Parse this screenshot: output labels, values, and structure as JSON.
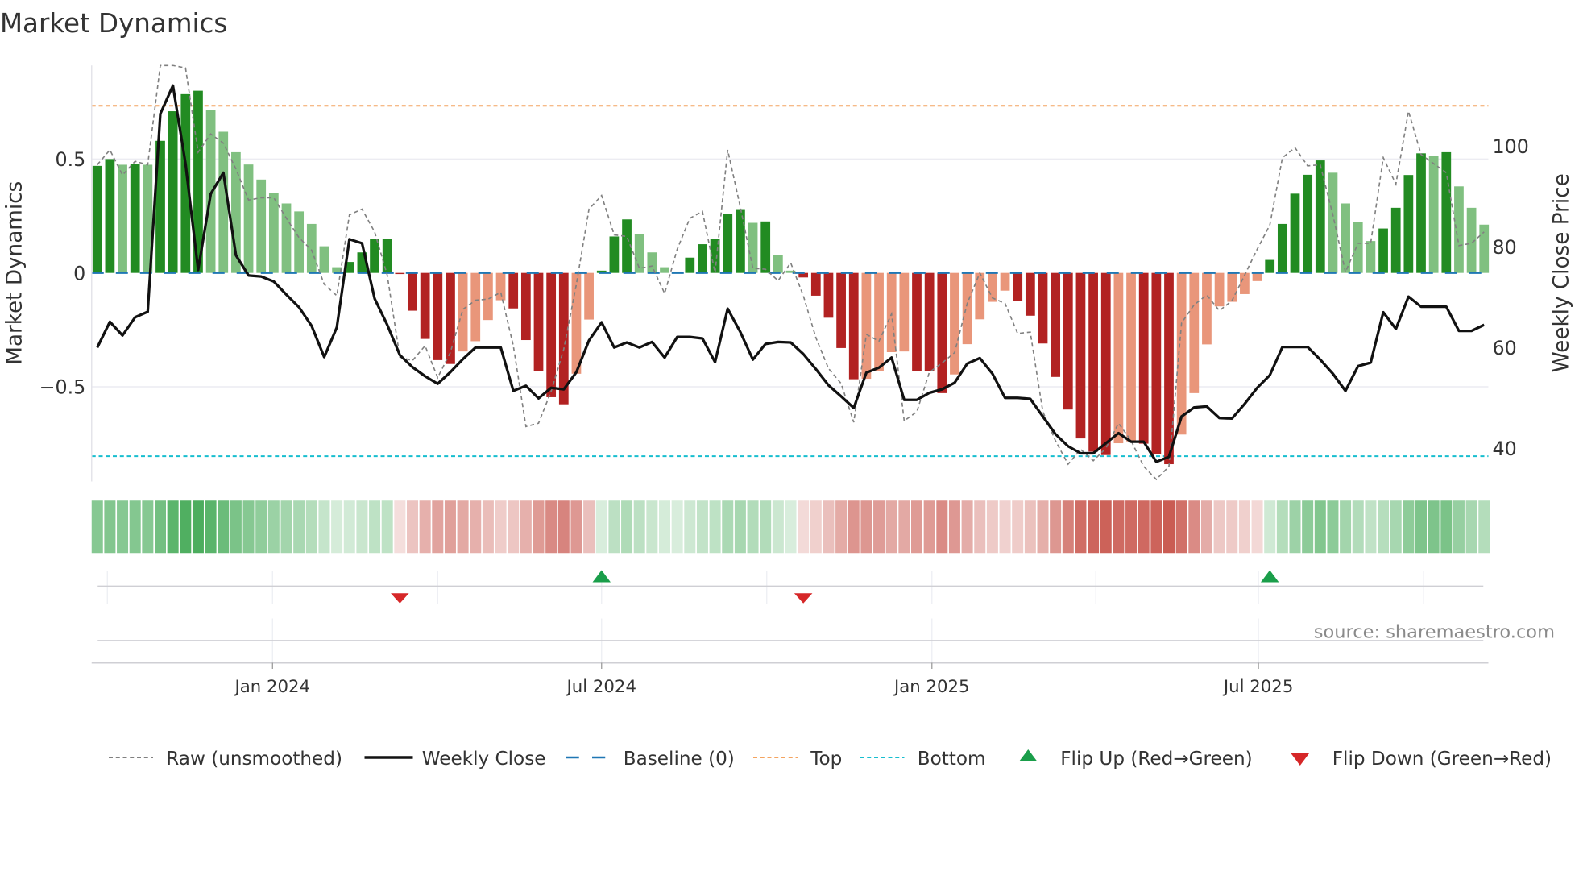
{
  "chart_data": {
    "type": "bar",
    "title": "Market Dynamics",
    "ylabel": "Market Dynamics",
    "y2label": "Weekly Close Price",
    "ylim": [
      -0.916,
      0.911
    ],
    "y2lim": [
      33.4,
      116
    ],
    "yticks": [
      {
        "v": 0.5,
        "label": "0.5"
      },
      {
        "v": 0,
        "label": "0"
      },
      {
        "v": -0.5,
        "label": "−0.5"
      }
    ],
    "y2ticks": [
      {
        "v": 100,
        "label": "100"
      },
      {
        "v": 80,
        "label": "80"
      },
      {
        "v": 60,
        "label": "60"
      },
      {
        "v": 40,
        "label": "40"
      }
    ],
    "x_unit": "week index",
    "xticks": [
      {
        "i": 13.9,
        "label": "Jan 2024"
      },
      {
        "i": 40.0,
        "label": "Jul 2024"
      },
      {
        "i": 66.2,
        "label": "Jan 2025"
      },
      {
        "i": 92.1,
        "label": "Jul 2025"
      }
    ],
    "quarter_grid": [
      0.8,
      13.9,
      27.0,
      40.0,
      53.1,
      66.2,
      79.2,
      92.1,
      105.2
    ],
    "top_level": 0.734,
    "bottom_level": -0.805,
    "baseline": 0,
    "series": [
      {
        "name": "Market Dynamics (smoothed)",
        "values": [
          0.47,
          0.5,
          0.475,
          0.48,
          0.475,
          0.58,
          0.71,
          0.785,
          0.8,
          0.716,
          0.62,
          0.53,
          0.476,
          0.41,
          0.35,
          0.305,
          0.27,
          0.215,
          0.117,
          0.025,
          0.048,
          0.09,
          0.148,
          0.15,
          -0.005,
          -0.166,
          -0.29,
          -0.383,
          -0.4,
          -0.345,
          -0.3,
          -0.207,
          -0.12,
          -0.156,
          -0.295,
          -0.432,
          -0.546,
          -0.577,
          -0.443,
          -0.205,
          0.01,
          0.16,
          0.235,
          0.17,
          0.09,
          0.025,
          0.006,
          0.067,
          0.126,
          0.15,
          0.26,
          0.28,
          0.22,
          0.226,
          0.08,
          0.01,
          -0.02,
          -0.1,
          -0.197,
          -0.33,
          -0.467,
          -0.465,
          -0.43,
          -0.348,
          -0.345,
          -0.432,
          -0.432,
          -0.528,
          -0.446,
          -0.313,
          -0.204,
          -0.127,
          -0.078,
          -0.122,
          -0.188,
          -0.31,
          -0.457,
          -0.6,
          -0.727,
          -0.785,
          -0.8,
          -0.748,
          -0.74,
          -0.75,
          -0.794,
          -0.84,
          -0.71,
          -0.528,
          -0.314,
          -0.147,
          -0.127,
          -0.093,
          -0.036,
          0.057,
          0.215,
          0.348,
          0.431,
          0.494,
          0.44,
          0.305,
          0.225,
          0.14,
          0.195,
          0.286,
          0.43,
          0.525,
          0.515,
          0.53,
          0.38,
          0.286,
          0.212
        ]
      },
      {
        "name": "Weekly Close",
        "values": [
          60.0,
          65.1,
          62.4,
          66.0,
          67.1,
          106.4,
          112.0,
          96.5,
          75.4,
          90.5,
          94.7,
          78.3,
          74.3,
          74.1,
          73.1,
          70.5,
          68.0,
          64.3,
          58.1,
          64.0,
          81.5,
          80.7,
          69.7,
          64.5,
          58.5,
          56.1,
          54.3,
          52.8,
          55.1,
          57.7,
          60.0,
          60.0,
          60.0,
          51.4,
          52.4,
          49.9,
          52.0,
          51.7,
          55.1,
          61.4,
          65.0,
          60.0,
          61.0,
          60.0,
          61.1,
          58.0,
          62.1,
          62.1,
          61.8,
          57.1,
          67.7,
          63.1,
          57.6,
          60.7,
          61.1,
          61.0,
          58.7,
          55.7,
          52.5,
          50.3,
          48.0,
          55.0,
          56.0,
          58.0,
          49.6,
          49.6,
          51.0,
          51.7,
          53.0,
          56.8,
          57.9,
          54.8,
          50.0,
          50.0,
          49.8,
          46.3,
          42.8,
          40.4,
          39.0,
          39.0,
          41.0,
          43.0,
          41.3,
          41.3,
          37.3,
          38.3,
          46.3,
          48.1,
          48.3,
          46.0,
          45.9,
          48.8,
          52.0,
          54.5,
          60.1,
          60.1,
          60.1,
          57.6,
          54.8,
          51.4,
          56.3,
          57.0,
          67.0,
          63.7,
          70.1,
          68.1,
          68.1,
          68.1,
          63.3,
          63.3,
          64.5
        ]
      },
      {
        "name": "Raw (unsmoothed)",
        "values": [
          0.475,
          0.54,
          0.43,
          0.49,
          0.475,
          0.93,
          0.95,
          0.9,
          0.53,
          0.61,
          0.57,
          0.456,
          0.32,
          0.33,
          0.33,
          0.24,
          0.155,
          0.1,
          -0.05,
          -0.1,
          0.255,
          0.28,
          0.18,
          -0.01,
          -0.37,
          -0.385,
          -0.32,
          -0.46,
          -0.35,
          -0.16,
          -0.12,
          -0.115,
          -0.085,
          -0.32,
          -0.675,
          -0.66,
          -0.52,
          -0.335,
          -0.05,
          0.28,
          0.34,
          0.167,
          0.16,
          0.02,
          0.03,
          -0.09,
          0.104,
          0.24,
          0.27,
          0.0,
          0.54,
          0.29,
          0.02,
          0.016,
          -0.034,
          0.044,
          -0.1,
          -0.285,
          -0.42,
          -0.486,
          -0.656,
          -0.27,
          -0.3,
          -0.18,
          -0.65,
          -0.61,
          -0.436,
          -0.396,
          -0.35,
          -0.134,
          0.0,
          -0.11,
          -0.134,
          -0.266,
          -0.26,
          -0.61,
          -0.737,
          -0.84,
          -0.775,
          -0.825,
          -0.77,
          -0.66,
          -0.737,
          -0.85,
          -0.907,
          -0.85,
          -0.22,
          -0.14,
          -0.097,
          -0.166,
          -0.122,
          -0.01,
          0.104,
          0.21,
          0.506,
          0.55,
          0.47,
          0.475,
          0.255,
          0.004,
          0.13,
          0.13,
          0.506,
          0.39,
          0.71,
          0.52,
          0.48,
          0.44,
          0.12,
          0.13,
          0.18
        ]
      }
    ],
    "flips": [
      {
        "i": 24,
        "dir": "down"
      },
      {
        "i": 40,
        "dir": "up"
      },
      {
        "i": 56,
        "dir": "down"
      },
      {
        "i": 93,
        "dir": "up"
      }
    ],
    "colors": {
      "pos_strong": "#228b22",
      "pos_weak": "#80c080",
      "neg_strong": "#b22222",
      "neg_weak": "#e9967a",
      "close": "#111111",
      "raw": "#808080",
      "baseline": "#1f77b4",
      "top": "#f4a460",
      "bottom": "#17becf",
      "flip_up": "#1a9e4a",
      "flip_down": "#d62728"
    },
    "legend": [
      {
        "label": "Raw (unsmoothed)",
        "kind": "raw"
      },
      {
        "label": "Weekly Close",
        "kind": "close"
      },
      {
        "label": "Baseline (0)",
        "kind": "baseline"
      },
      {
        "label": "Top",
        "kind": "top"
      },
      {
        "label": "Bottom",
        "kind": "bottom"
      },
      {
        "label": "Flip Up (Red→Green)",
        "kind": "up"
      },
      {
        "label": "Flip Down (Green→Red)",
        "kind": "down"
      }
    ],
    "legend_position": "bottom",
    "source": "source: sharemaestro.com"
  }
}
